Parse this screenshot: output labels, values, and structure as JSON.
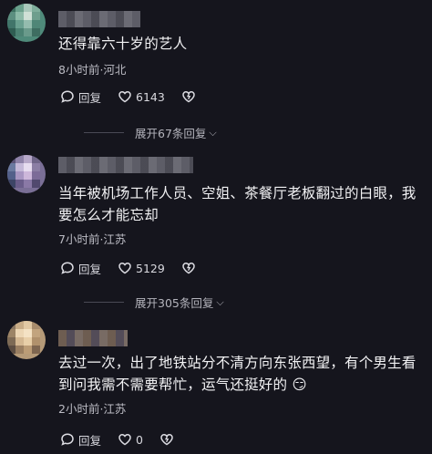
{
  "comments": [
    {
      "text": "还得靠六十岁的艺人",
      "meta": "8小时前·河北",
      "reply_label": "回复",
      "like_count": "6143",
      "expand_label": "展开67条回复"
    },
    {
      "text": "当年被机场工作人员、空姐、茶餐厅老板翻过的白眼，我要怎么才能忘却",
      "meta": "7小时前·江苏",
      "reply_label": "回复",
      "like_count": "5129",
      "expand_label": "展开305条回复"
    },
    {
      "text": "去过一次，出了地铁站分不清方向东张西望，有个男生看到问我需不需要帮忙，运气还挺好的 😏",
      "meta": "2小时前·江苏",
      "reply_label": "回复",
      "like_count": "0"
    }
  ],
  "colors": {
    "background": "#15151d",
    "text": "#f2f2f4",
    "meta": "#bcbcc4"
  },
  "icons": [
    "reply-bubble-icon",
    "heart-icon",
    "dislike-heart-icon",
    "chevron-down-icon"
  ]
}
